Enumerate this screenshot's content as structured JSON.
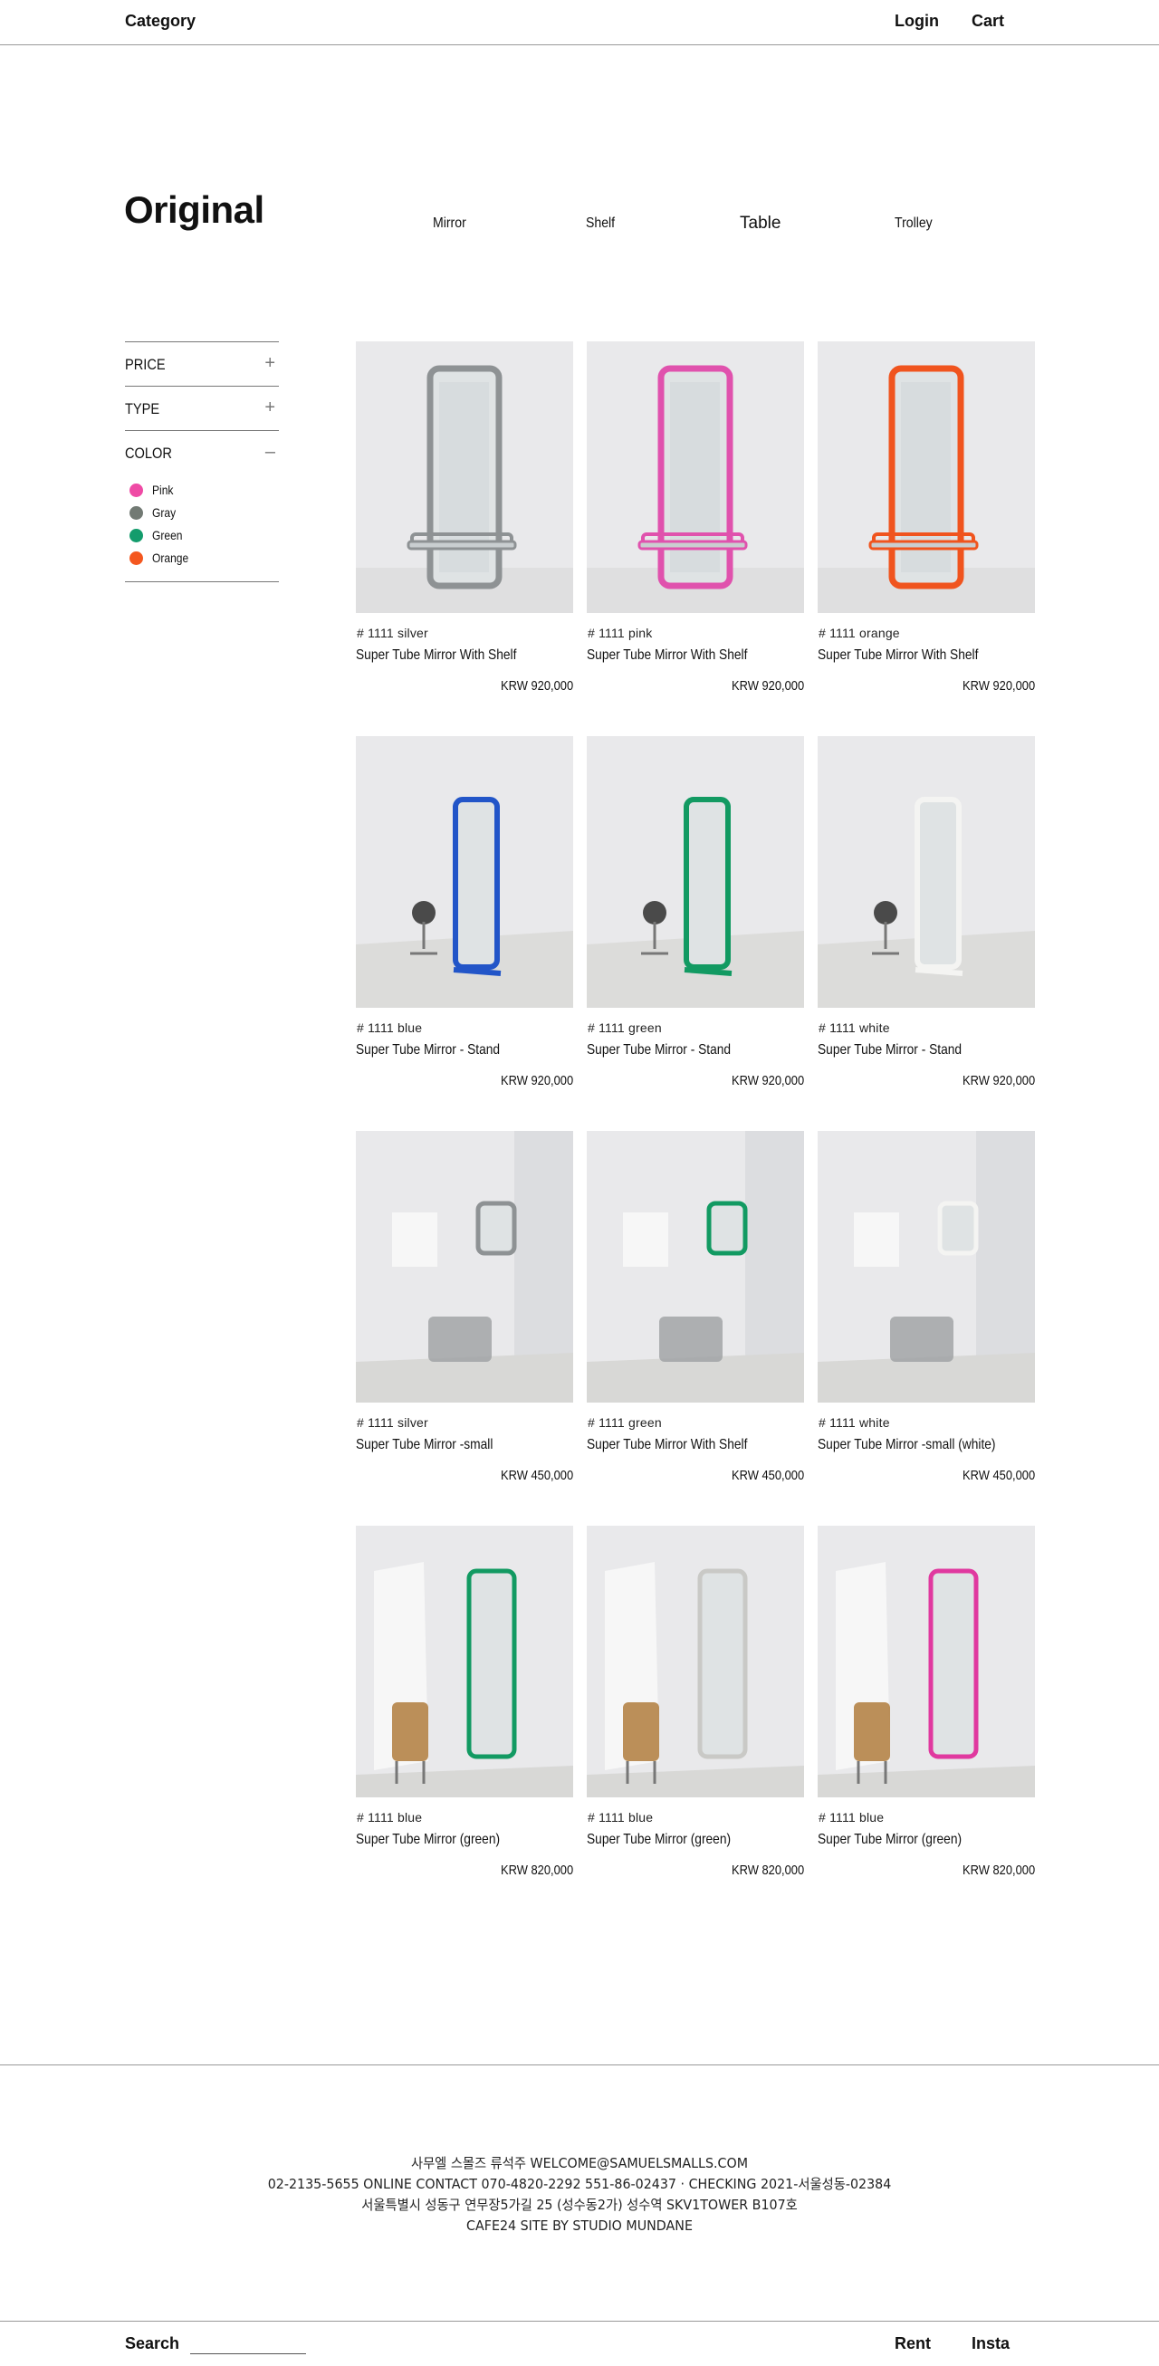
{
  "header": {
    "category": "Category",
    "login": "Login",
    "cart": "Cart"
  },
  "page_title": "Original",
  "subnav": [
    {
      "label": "Mirror",
      "selected": false
    },
    {
      "label": "Shelf",
      "selected": false
    },
    {
      "label": "Table",
      "selected": true
    },
    {
      "label": "Trolley",
      "selected": false
    }
  ],
  "filters": {
    "price": {
      "label": "PRICE",
      "toggle": "+"
    },
    "type": {
      "label": "TYPE",
      "toggle": "+"
    },
    "color": {
      "label": "COLOR",
      "toggle": "–",
      "options": [
        {
          "name": "Pink",
          "color": "#ef4aa5"
        },
        {
          "name": "Gray",
          "color": "#727a74"
        },
        {
          "name": "Green",
          "color": "#139c6c"
        },
        {
          "name": "Orange",
          "color": "#f4571f"
        }
      ]
    }
  },
  "products": [
    {
      "code": "# 1111 silver",
      "name": "Super Tube Mirror With Shelf",
      "price": "KRW 920,000",
      "frame_color": "#8e9294",
      "scene": "shelf"
    },
    {
      "code": "# 1111 pink",
      "name": "Super Tube Mirror With Shelf",
      "price": "KRW 920,000",
      "frame_color": "#e052ad",
      "scene": "shelf"
    },
    {
      "code": "# 1111 orange",
      "name": "Super Tube Mirror With Shelf",
      "price": "KRW 920,000",
      "frame_color": "#f0541e",
      "scene": "shelf"
    },
    {
      "code": "# 1111 blue",
      "name": "Super Tube Mirror - Stand",
      "price": "KRW 920,000",
      "frame_color": "#2255c8",
      "scene": "stand"
    },
    {
      "code": "# 1111 green",
      "name": "Super Tube Mirror - Stand",
      "price": "KRW 920,000",
      "frame_color": "#129a62",
      "scene": "stand"
    },
    {
      "code": "# 1111 white",
      "name": "Super Tube Mirror - Stand",
      "price": "KRW 920,000",
      "frame_color": "#f4f4f2",
      "scene": "stand"
    },
    {
      "code": "# 1111 silver",
      "name": "Super Tube Mirror -small",
      "price": "KRW 450,000",
      "frame_color": "#8e9294",
      "scene": "small"
    },
    {
      "code": "# 1111 green",
      "name": "Super Tube Mirror With Shelf",
      "price": "KRW 450,000",
      "frame_color": "#129a62",
      "scene": "small"
    },
    {
      "code": "# 1111 white",
      "name": "Super Tube Mirror -small (white)",
      "price": "KRW 450,000",
      "frame_color": "#f4f4f2",
      "scene": "small"
    },
    {
      "code": "# 1111 blue",
      "name": "Super Tube Mirror (green)",
      "price": "KRW 820,000",
      "frame_color": "#129a62",
      "scene": "tall"
    },
    {
      "code": "# 1111 blue",
      "name": "Super Tube Mirror (green)",
      "price": "KRW 820,000",
      "frame_color": "#c9c9c6",
      "scene": "tall"
    },
    {
      "code": "# 1111 blue",
      "name": "Super Tube Mirror (green)",
      "price": "KRW 820,000",
      "frame_color": "#e0399f",
      "scene": "tall"
    }
  ],
  "footer": {
    "lines": [
      "사무엘 스몰즈 류석주 WELCOME@SAMUELSMALLS.COM",
      "02-2135-5655 ONLINE CONTACT 070-4820-2292 551-86-02437 · CHECKING 2021-서울성동-02384",
      "서울특별시 성동구 연무장5가길 25 (성수동2가) 성수역 SKV1TOWER B107호",
      "CAFE24 SITE BY STUDIO MUNDANE"
    ],
    "search_label": "Search",
    "search_placeholder": "",
    "rent": "Rent",
    "insta": "Insta"
  }
}
